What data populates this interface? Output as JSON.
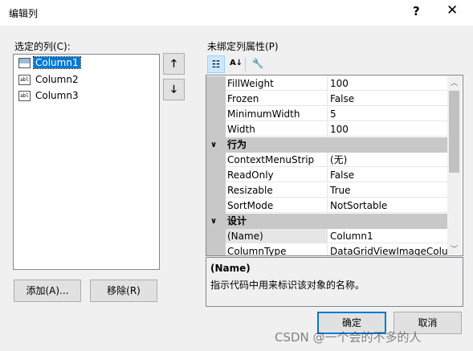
{
  "window": {
    "title": "编辑列",
    "help": "?",
    "close": "✕"
  },
  "left": {
    "label": "选定的列(C):",
    "columns": [
      {
        "name": "Column1",
        "icon": "image-column-icon",
        "selected": true
      },
      {
        "name": "Column2",
        "icon": "textbox-column-icon",
        "selected": false
      },
      {
        "name": "Column3",
        "icon": "textbox-column-icon",
        "selected": false
      }
    ],
    "move_up": "🡑",
    "move_down": "🡓",
    "add": "添加(A)...",
    "remove": "移除(R)"
  },
  "right": {
    "label": "未绑定列属性(P)",
    "toolbar": {
      "categorized": "☷",
      "alphabetical": "A↓",
      "wrench": "🔧"
    },
    "props_top": [
      {
        "name": "FillWeight",
        "value": "100"
      },
      {
        "name": "Frozen",
        "value": "False"
      },
      {
        "name": "MinimumWidth",
        "value": "5"
      },
      {
        "name": "Width",
        "value": "100"
      }
    ],
    "category_behavior": "行为",
    "props_behavior": [
      {
        "name": "ContextMenuStrip",
        "value": "(无)"
      },
      {
        "name": "ReadOnly",
        "value": "False"
      },
      {
        "name": "Resizable",
        "value": "True"
      },
      {
        "name": "SortMode",
        "value": "NotSortable"
      }
    ],
    "category_design": "设计",
    "props_design": [
      {
        "name": "(Name)",
        "value": "Column1"
      },
      {
        "name": "ColumnType",
        "value": "DataGridViewImageColumn"
      }
    ],
    "description": {
      "title": "(Name)",
      "text": "指示代码中用来标识该对象的名称。"
    }
  },
  "buttons": {
    "ok": "确定",
    "cancel": "取消"
  },
  "watermark": "CSDN @一个会的不多的人"
}
